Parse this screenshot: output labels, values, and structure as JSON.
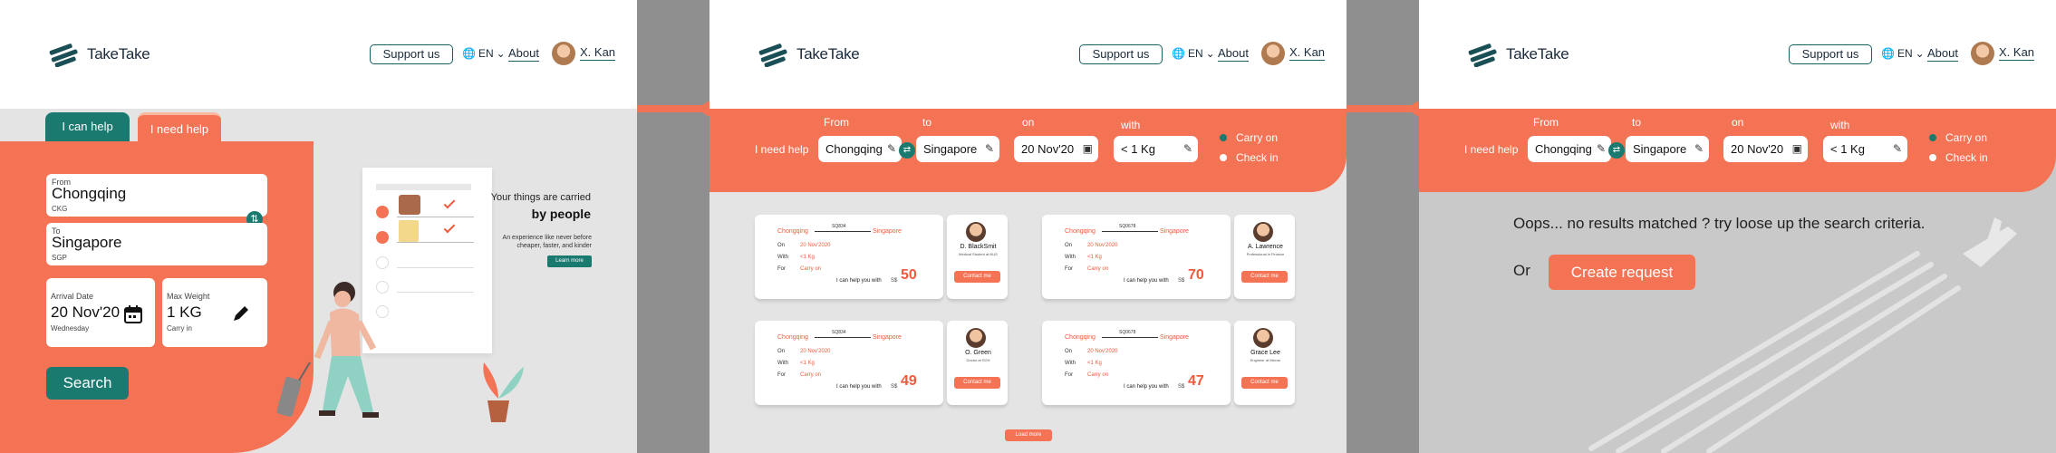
{
  "header": {
    "brand": "TakeTake",
    "support_label": "Support us",
    "language": "EN",
    "about_label": "About",
    "user_name": "X. Kan"
  },
  "screen1": {
    "tab_help": "I can help",
    "tab_need": "I need help",
    "from": {
      "label": "From",
      "value": "Chongqing",
      "code": "CKG"
    },
    "to": {
      "label": "To",
      "value": "Singapore",
      "code": "SGP"
    },
    "arrival": {
      "label": "Arrival Date",
      "value": "20 Nov'20",
      "sub": "Wednesday"
    },
    "weight": {
      "label": "Max Weight",
      "value": "1 KG",
      "sub": "Carry in"
    },
    "search_label": "Search",
    "promo_line1": "Your things are carried",
    "promo_line2": "by people",
    "promo_line3": "An experience like never before cheaper, faster, and kinder",
    "learn_more": "Learn more"
  },
  "search_bar": {
    "need_label": "I need help",
    "from_label": "From",
    "to_label": "to",
    "on_label": "on",
    "with_label": "with",
    "from_value": "Chongqing",
    "to_value": "Singapore",
    "date_value": "20 Nov'20",
    "weight_value": "< 1 Kg",
    "opt_carry": "Carry on",
    "opt_check": "Check in"
  },
  "card_labels": {
    "on": "On",
    "with": "With",
    "for": "For",
    "can_help": "I can help you with",
    "currency": "S$",
    "contact": "Contact me"
  },
  "results": [
    {
      "from": "Chongqing",
      "to": "Singapore",
      "code": "SQ834",
      "date": "20 Nov'2020",
      "weight": "<1 Kg",
      "type": "Carry on",
      "price": "50",
      "name": "D. BlackSmit",
      "role": "Medical Student at NUS"
    },
    {
      "from": "Chongqing",
      "to": "Singapore",
      "code": "SQ0678",
      "date": "20 Nov'2020",
      "weight": "<1 Kg",
      "type": "Carry on",
      "price": "70",
      "name": "A. Lawrence",
      "role": "Professional in Finance"
    },
    {
      "from": "Chongqing",
      "to": "Singapore",
      "code": "SQ834",
      "date": "20 Nov'2020",
      "weight": "<1 Kg",
      "type": "Carry on",
      "price": "49",
      "name": "O. Green",
      "role": "Doctor at SGH"
    },
    {
      "from": "Chongqing",
      "to": "Singapore",
      "code": "SQ0678",
      "date": "20 Nov'2020",
      "weight": "<1 Kg",
      "type": "Carry on",
      "price": "47",
      "name": "Grace Lee",
      "role": "Engineer at Micron"
    }
  ],
  "load_more": "Load more",
  "empty": {
    "message": "Oops... no results matched ? try loose up the search criteria.",
    "or_label": "Or",
    "create_label": "Create request"
  },
  "colors": {
    "accent": "#f57355",
    "teal": "#1b7a70",
    "panel_bg": "#e4e4e4"
  }
}
